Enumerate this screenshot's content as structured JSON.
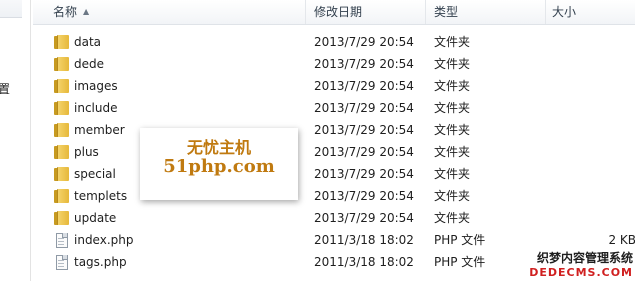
{
  "nav": {
    "partial_label": "置"
  },
  "columns": {
    "name": "名称",
    "date": "修改日期",
    "type": "类型",
    "size": "大小"
  },
  "files": [
    {
      "name": "data",
      "date": "2013/7/29 20:54",
      "type": "文件夹",
      "size": "",
      "icon": "folder-icon"
    },
    {
      "name": "dede",
      "date": "2013/7/29 20:54",
      "type": "文件夹",
      "size": "",
      "icon": "folder-icon"
    },
    {
      "name": "images",
      "date": "2013/7/29 20:54",
      "type": "文件夹",
      "size": "",
      "icon": "folder-icon"
    },
    {
      "name": "include",
      "date": "2013/7/29 20:54",
      "type": "文件夹",
      "size": "",
      "icon": "folder-icon"
    },
    {
      "name": "member",
      "date": "2013/7/29 20:54",
      "type": "文件夹",
      "size": "",
      "icon": "folder-icon"
    },
    {
      "name": "plus",
      "date": "2013/7/29 20:54",
      "type": "文件夹",
      "size": "",
      "icon": "folder-icon"
    },
    {
      "name": "special",
      "date": "2013/7/29 20:54",
      "type": "文件夹",
      "size": "",
      "icon": "folder-icon"
    },
    {
      "name": "templets",
      "date": "2013/7/29 20:54",
      "type": "文件夹",
      "size": "",
      "icon": "folder-icon"
    },
    {
      "name": "update",
      "date": "2013/7/29 20:54",
      "type": "文件夹",
      "size": "",
      "icon": "folder-icon"
    },
    {
      "name": "index.php",
      "date": "2011/3/18 18:02",
      "type": "PHP 文件",
      "size": "2 KB",
      "icon": "php-file-icon"
    },
    {
      "name": "tags.php",
      "date": "2011/3/18 18:02",
      "type": "PHP 文件",
      "size": "",
      "icon": "php-file-icon"
    }
  ],
  "callout": {
    "line1": "无忧主机",
    "line2": "51php.com"
  },
  "watermark": {
    "line1": "织梦内容管理系统",
    "line2": "DEDECMS.COM"
  },
  "colors": {
    "callout_text": "#c07a10",
    "folder": "#e6b83a",
    "watermark_red": "#d02020"
  }
}
